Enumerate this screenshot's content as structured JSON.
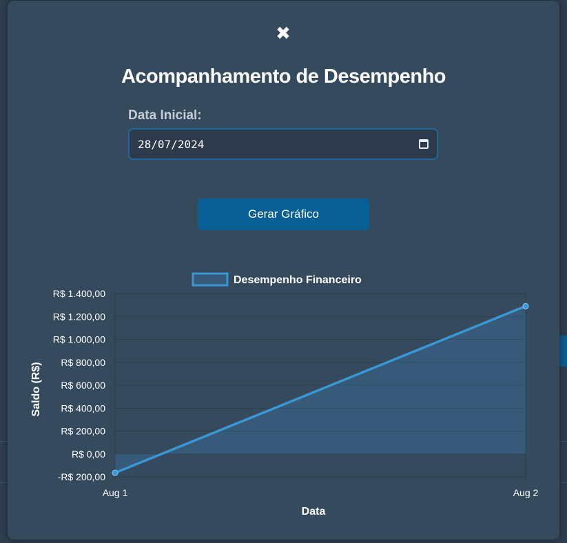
{
  "modal": {
    "close_glyph": "✖",
    "title": "Acompanhamento de Desempenho",
    "date_label": "Data Inicial:",
    "date_value": "28/07/2024",
    "button_label": "Gerar Gráfico"
  },
  "colors": {
    "accent": "#3a97d6",
    "button": "#075f95",
    "modal_bg": "#364a5e"
  },
  "chart_data": {
    "type": "area",
    "categories": [
      "Aug 1",
      "Aug 2"
    ],
    "series": [
      {
        "name": "Desempenho Financeiro",
        "values": [
          -165,
          1290
        ]
      }
    ],
    "xlabel": "Data",
    "ylabel": "Saldo (R$)",
    "ylim": [
      -200,
      1400
    ],
    "yticks": [
      "R$ 1.400,00",
      "R$ 1.200,00",
      "R$ 1.000,00",
      "R$ 800,00",
      "R$ 600,00",
      "R$ 400,00",
      "R$ 200,00",
      "R$ 0,00",
      "-R$ 200,00"
    ],
    "ytick_values": [
      1400,
      1200,
      1000,
      800,
      600,
      400,
      200,
      0,
      -200
    ],
    "legend_position": "top-center",
    "grid": true
  }
}
